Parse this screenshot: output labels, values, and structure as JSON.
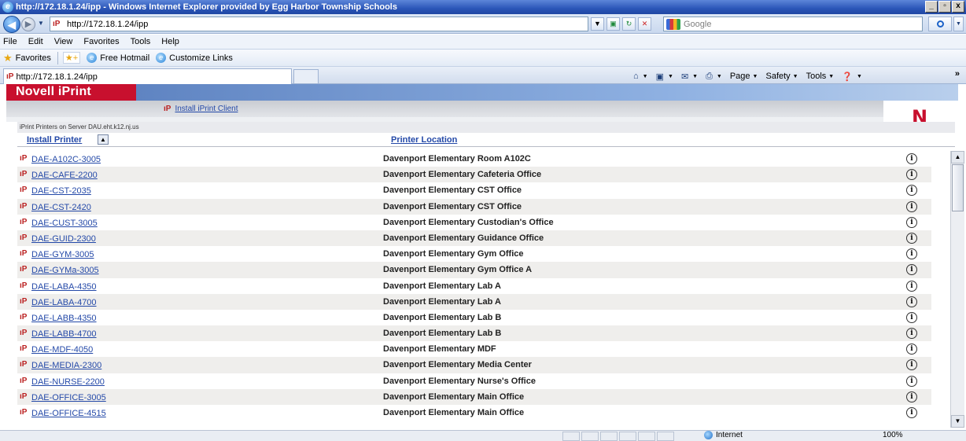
{
  "window": {
    "title": "http://172.18.1.24/ipp - Windows Internet Explorer provided by Egg Harbor Township Schools",
    "controls": [
      "_",
      "▫",
      "x"
    ]
  },
  "address": {
    "url": "http://172.18.1.24/ipp",
    "search_placeholder": "Google"
  },
  "menu": [
    "File",
    "Edit",
    "View",
    "Favorites",
    "Tools",
    "Help"
  ],
  "favorites_bar": {
    "label": "Favorites",
    "links": [
      "Free Hotmail",
      "Customize Links"
    ]
  },
  "tab": {
    "label": "http://172.18.1.24/ipp"
  },
  "command_bar": [
    "Page",
    "Safety",
    "Tools"
  ],
  "page": {
    "brand": "Novell iPrint",
    "logo_letter": "N",
    "install_client_label": "Install iPrint Client",
    "server_line": "iPrint Printers on Server DAU.eht.k12.nj.us",
    "col_install": "Install Printer",
    "col_location": "Printer Location",
    "printers": [
      {
        "name": "DAE-A102C-3005",
        "location": "Davenport Elementary Room A102C"
      },
      {
        "name": "DAE-CAFE-2200",
        "location": "Davenport Elementary Cafeteria Office"
      },
      {
        "name": "DAE-CST-2035",
        "location": "Davenport Elementary CST Office"
      },
      {
        "name": "DAE-CST-2420",
        "location": "Davenport Elementary CST Office"
      },
      {
        "name": "DAE-CUST-3005",
        "location": "Davenport Elementary Custodian's Office"
      },
      {
        "name": "DAE-GUID-2300",
        "location": "Davenport Elementary Guidance Office"
      },
      {
        "name": "DAE-GYM-3005",
        "location": "Davenport Elementary Gym Office"
      },
      {
        "name": "DAE-GYMa-3005",
        "location": "Davenport Elementary Gym Office A"
      },
      {
        "name": "DAE-LABA-4350",
        "location": "Davenport Elementary Lab A"
      },
      {
        "name": "DAE-LABA-4700",
        "location": "Davenport Elementary Lab A"
      },
      {
        "name": "DAE-LABB-4350",
        "location": "Davenport Elementary Lab B"
      },
      {
        "name": "DAE-LABB-4700",
        "location": "Davenport Elementary Lab B"
      },
      {
        "name": "DAE-MDF-4050",
        "location": "Davenport Elementary MDF"
      },
      {
        "name": "DAE-MEDIA-2300",
        "location": "Davenport Elementary Media Center"
      },
      {
        "name": "DAE-NURSE-2200",
        "location": "Davenport Elementary Nurse's Office"
      },
      {
        "name": "DAE-OFFICE-3005",
        "location": "Davenport Elementary Main Office"
      },
      {
        "name": "DAE-OFFICE-4515",
        "location": "Davenport Elementary Main Office"
      }
    ]
  },
  "status": {
    "zone": "Internet",
    "zoom": "100%"
  },
  "colors": {
    "brand_red": "#c8102e",
    "link_blue": "#2449a8",
    "row_alt": "#efeeec"
  }
}
